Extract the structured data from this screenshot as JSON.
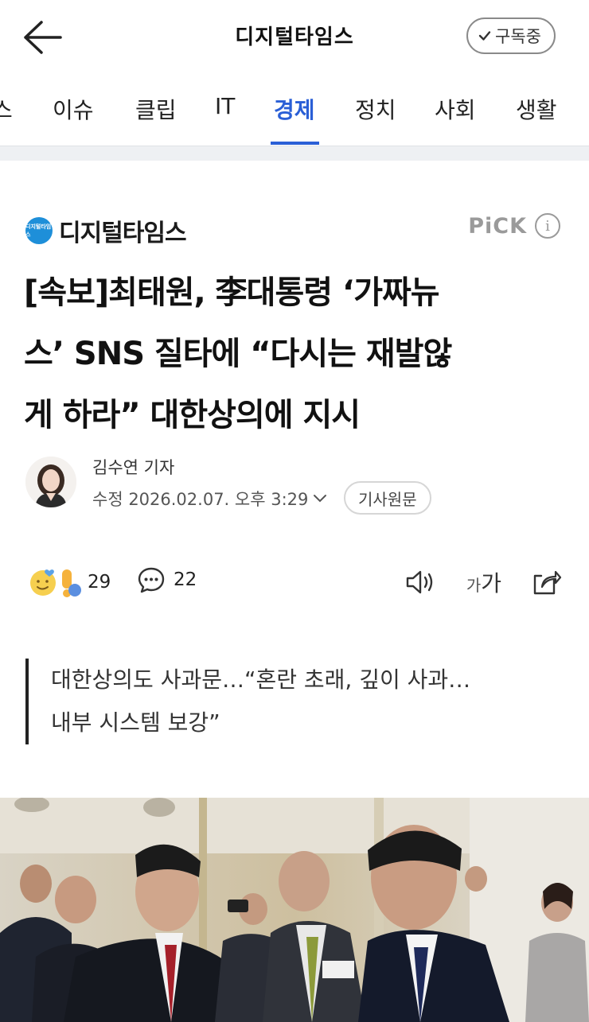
{
  "header": {
    "title": "디지털타임스",
    "subscribe_label": "구독중"
  },
  "tabs": [
    {
      "label": "스",
      "active": false
    },
    {
      "label": "이슈",
      "active": false
    },
    {
      "label": "클립",
      "active": false
    },
    {
      "label": "IT",
      "active": false
    },
    {
      "label": "경제",
      "active": true
    },
    {
      "label": "정치",
      "active": false
    },
    {
      "label": "사회",
      "active": false
    },
    {
      "label": "생활",
      "active": false
    }
  ],
  "colors": {
    "accent": "#2a5fd6",
    "publisher_logo": "#1e8fd9"
  },
  "article": {
    "publisher": "디지털타임스",
    "publisher_logo_text": "디지털타임스",
    "pick_label": "PiCK",
    "headline_lines": [
      "[속보]최태원, 李대통령 ‘가짜뉴",
      "스’ SNS 질타에 “다시는 재발않",
      "게 하라” 대한상의에 지시"
    ],
    "reporter": "김수연 기자",
    "date_label": "수정 2026.02.07. 오후 3:29",
    "original_button": "기사원문",
    "reaction_count": "29",
    "comment_count": "22",
    "font_small": "가",
    "font_large": "가",
    "subheading_lines": [
      "대한상의도 사과문…“혼란 초래, 깊이 사과…",
      "내부 시스템 보강”"
    ]
  }
}
